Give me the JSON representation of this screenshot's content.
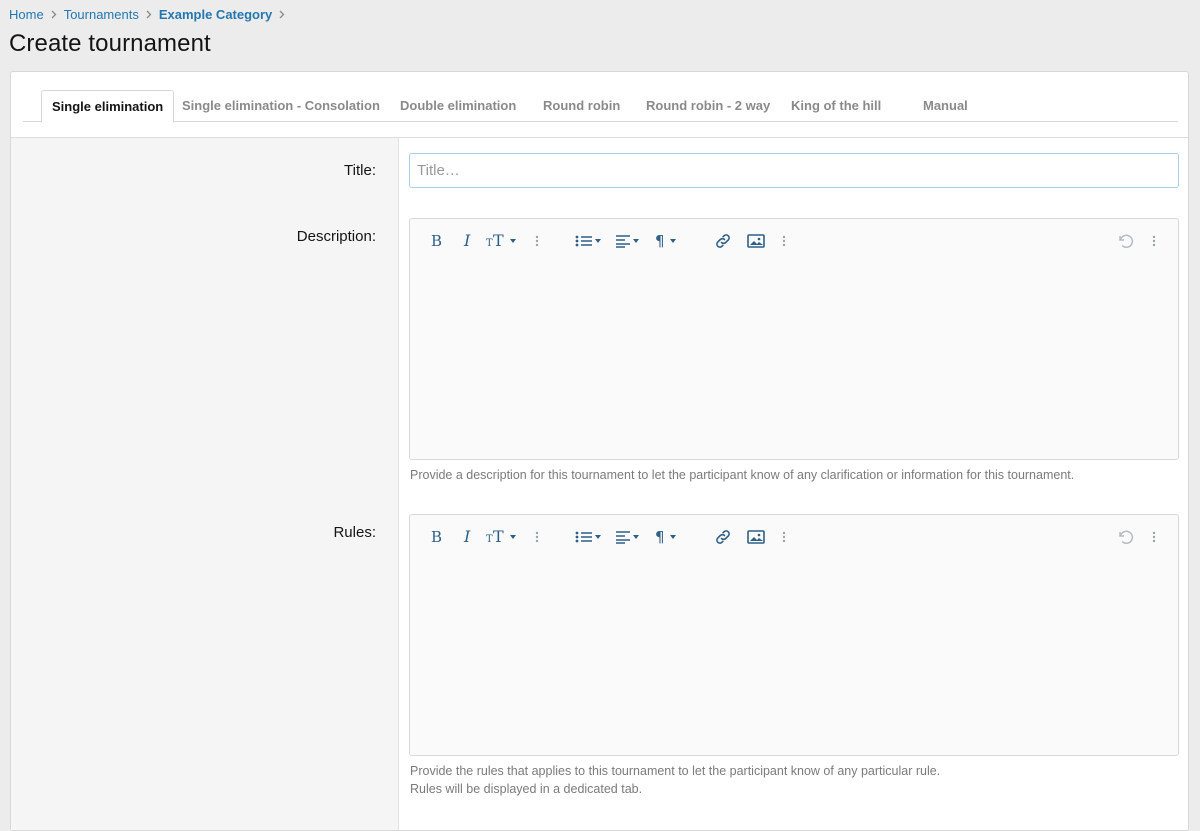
{
  "breadcrumb": {
    "items": [
      "Home",
      "Tournaments",
      "Example Category"
    ]
  },
  "page": {
    "title": "Create tournament"
  },
  "tabs": [
    {
      "label": "Single elimination",
      "active": true
    },
    {
      "label": "Single elimination - Consolation",
      "active": false
    },
    {
      "label": "Double elimination",
      "active": false
    },
    {
      "label": "Round robin",
      "active": false
    },
    {
      "label": "Round robin - 2 way",
      "active": false
    },
    {
      "label": "King of the hill",
      "active": false
    },
    {
      "label": "Manual",
      "active": false
    }
  ],
  "form": {
    "title_label": "Title:",
    "title_placeholder": "Title…",
    "title_value": "",
    "description_label": "Description:",
    "description_hint": "Provide a description for this tournament to let the participant know of any clarification or information for this tournament.",
    "rules_label": "Rules:",
    "rules_hint_line1": "Provide the rules that applies to this tournament to let the participant know of any particular rule.",
    "rules_hint_line2": "Rules will be displayed in a dedicated tab."
  },
  "colors": {
    "link": "#2577b1",
    "toolbar_icon": "#2e5f86",
    "input_focus_border": "#a9d0e6",
    "page_bg": "#ececec"
  },
  "editor_toolbar_icons": [
    "bold-icon",
    "italic-icon",
    "text-size-icon",
    "more-vertical-icon",
    "bullet-list-icon",
    "align-left-icon",
    "paragraph-icon",
    "link-icon",
    "image-icon",
    "more-vertical-icon",
    "undo-icon",
    "more-vertical-icon"
  ]
}
